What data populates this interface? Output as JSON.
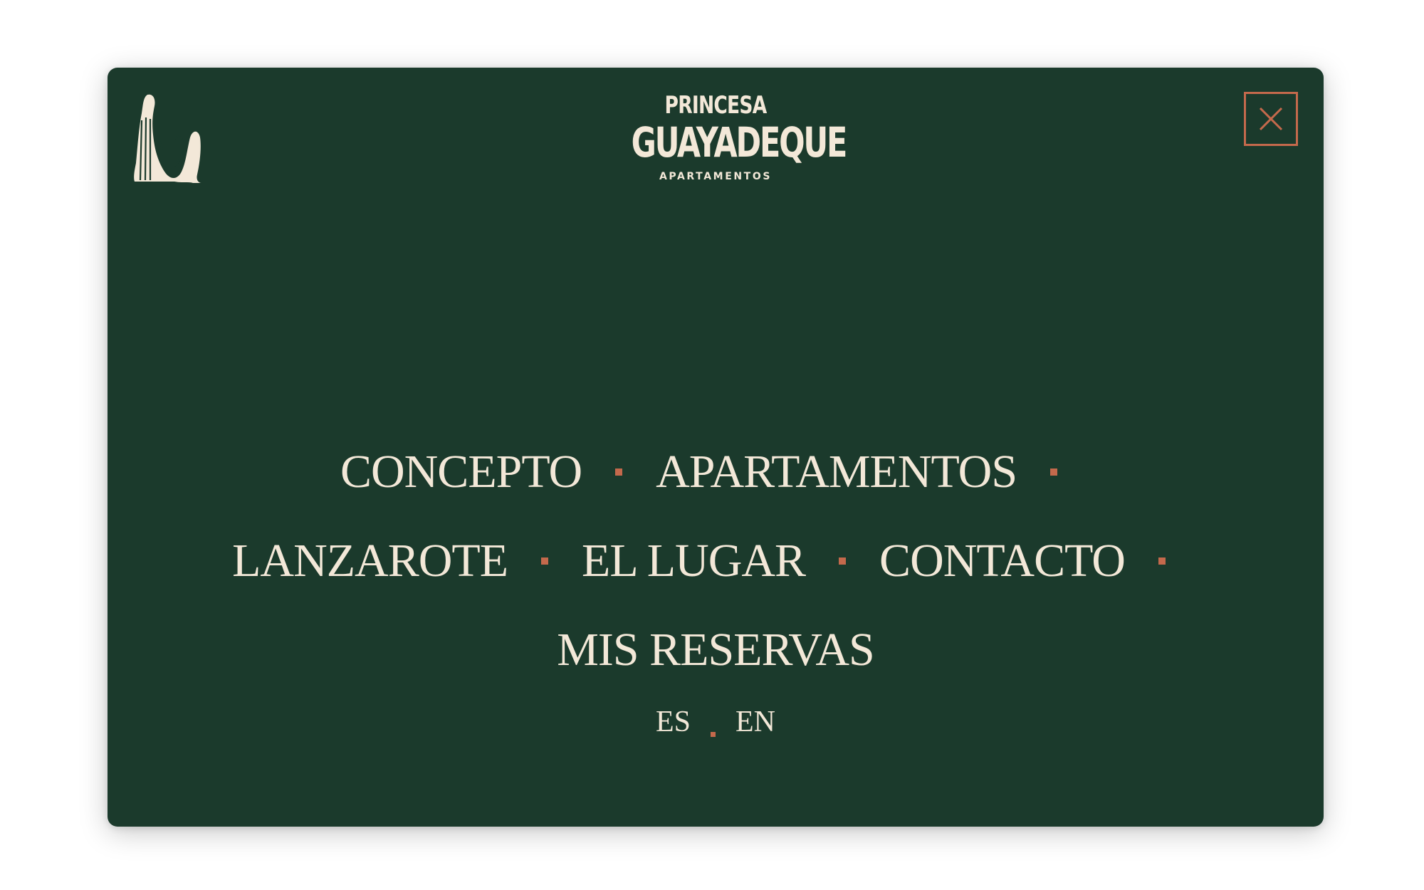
{
  "brand": {
    "line1": "PRINCESA",
    "line2": "GUAYADEQUE",
    "line3": "APARTAMENTOS"
  },
  "icons": {
    "mark": "seated-figure-logo-icon",
    "close": "close-icon"
  },
  "menu": {
    "rows": [
      [
        "CONCEPTO",
        "APARTAMENTOS"
      ],
      [
        "LANZAROTE",
        "EL LUGAR",
        "CONTACTO"
      ],
      [
        "MIS RESERVAS"
      ]
    ]
  },
  "languages": [
    "ES",
    "EN"
  ],
  "colors": {
    "background": "#1b3a2c",
    "text": "#f3e8d8",
    "accent": "#c4694c"
  }
}
